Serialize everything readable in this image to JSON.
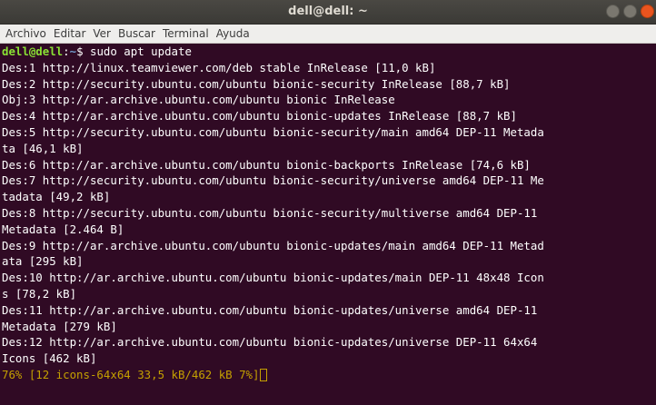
{
  "window": {
    "title": "dell@dell: ~"
  },
  "menu": [
    "Archivo",
    "Editar",
    "Ver",
    "Buscar",
    "Terminal",
    "Ayuda"
  ],
  "prompt": {
    "user_host": "dell@dell",
    "separator": ":",
    "path": "~",
    "symbol": "$",
    "command": " sudo apt update"
  },
  "output_lines": [
    "Des:1 http://linux.teamviewer.com/deb stable InRelease [11,0 kB]",
    "Des:2 http://security.ubuntu.com/ubuntu bionic-security InRelease [88,7 kB]",
    "Obj:3 http://ar.archive.ubuntu.com/ubuntu bionic InRelease",
    "Des:4 http://ar.archive.ubuntu.com/ubuntu bionic-updates InRelease [88,7 kB]",
    "Des:5 http://security.ubuntu.com/ubuntu bionic-security/main amd64 DEP-11 Metada",
    "ta [46,1 kB]",
    "Des:6 http://ar.archive.ubuntu.com/ubuntu bionic-backports InRelease [74,6 kB]",
    "Des:7 http://security.ubuntu.com/ubuntu bionic-security/universe amd64 DEP-11 Me",
    "tadata [49,2 kB]",
    "Des:8 http://security.ubuntu.com/ubuntu bionic-security/multiverse amd64 DEP-11",
    "Metadata [2.464 B]",
    "Des:9 http://ar.archive.ubuntu.com/ubuntu bionic-updates/main amd64 DEP-11 Metad",
    "ata [295 kB]",
    "Des:10 http://ar.archive.ubuntu.com/ubuntu bionic-updates/main DEP-11 48x48 Icon",
    "s [78,2 kB]",
    "Des:11 http://ar.archive.ubuntu.com/ubuntu bionic-updates/universe amd64 DEP-11",
    "Metadata [279 kB]",
    "Des:12 http://ar.archive.ubuntu.com/ubuntu bionic-updates/universe DEP-11 64x64",
    "Icons [462 kB]"
  ],
  "progress_line": "76% [12 icons-64x64 33,5 kB/462 kB 7%]",
  "colors": {
    "terminal_bg": "#300a24",
    "prompt_user": "#8ae234",
    "prompt_path": "#729fcf",
    "progress": "#c4a000"
  }
}
